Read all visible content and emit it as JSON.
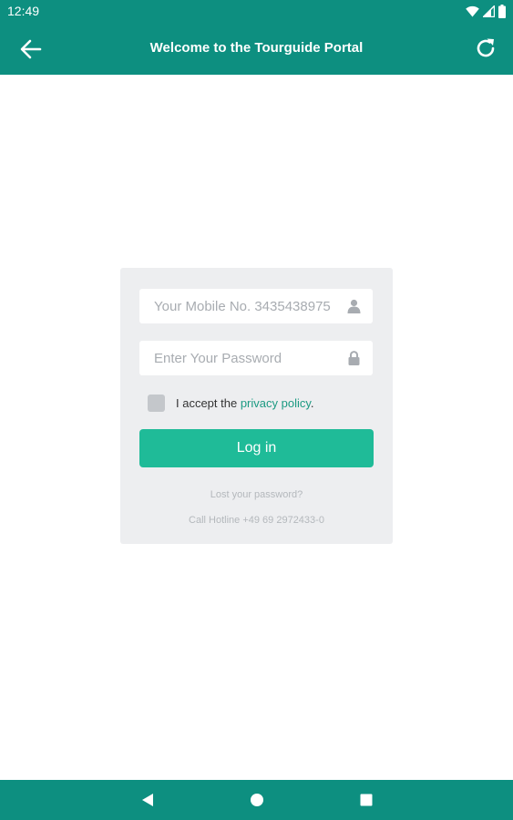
{
  "status_bar": {
    "time": "12:49",
    "icons": [
      "wifi-icon",
      "signal-icon",
      "battery-icon"
    ]
  },
  "app_bar": {
    "title": "Welcome to the Tourguide Portal",
    "icons": [
      "arrow-left-icon",
      "refresh-icon"
    ]
  },
  "login_form": {
    "mobile_placeholder": "Your Mobile No. 3435438975",
    "mobile_icon": "user-icon",
    "password_placeholder": "Enter Your Password",
    "password_icon": "lock-icon",
    "accept_prefix": "I accept the ",
    "privacy_link": "privacy policy",
    "accept_suffix": ".",
    "login_label": "Log in",
    "lost_password": "Lost your password?",
    "hotline": "Call Hotline +49 69 2972433-0"
  },
  "nav_bar": {
    "icons": [
      "nav-back-icon",
      "nav-home-icon",
      "nav-recents-icon"
    ]
  },
  "colors": {
    "primary": "#0d8f80",
    "button": "#1fbb98",
    "link": "#1c9a82",
    "card": "#edeef0"
  }
}
